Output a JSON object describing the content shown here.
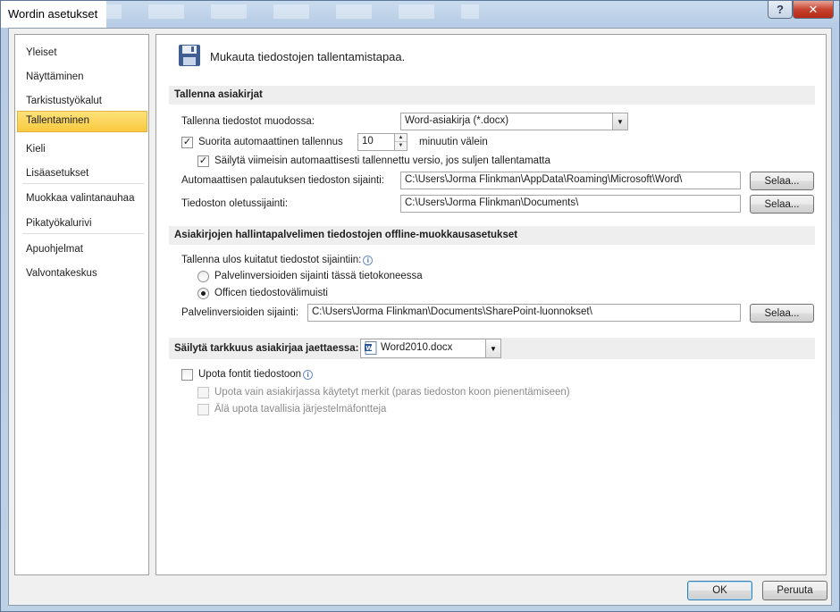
{
  "window": {
    "title": "Wordin asetukset",
    "help_label": "?",
    "close_label": "✕"
  },
  "sidebar": {
    "items": [
      {
        "label": "Yleiset"
      },
      {
        "label": "Näyttäminen"
      },
      {
        "label": "Tarkistustyökalut"
      },
      {
        "label": "Tallentaminen",
        "selected": true
      },
      {
        "label": "Kieli"
      },
      {
        "label": "Lisäasetukset"
      },
      {
        "label": "Muokkaa valintanauhaa"
      },
      {
        "label": "Pikatyökalurivi"
      },
      {
        "label": "Apuohjelmat"
      },
      {
        "label": "Valvontakeskus"
      }
    ]
  },
  "main": {
    "page_title": "Mukauta tiedostojen tallentamistapaa.",
    "save_docs": {
      "header": "Tallenna asiakirjat",
      "format_label": "Tallenna tiedostot muodossa:",
      "format_value": "Word-asiakirja (*.docx)",
      "autosave_label": "Suorita automaattinen tallennus",
      "autosave_checked": true,
      "autosave_minutes": "10",
      "autosave_suffix": "minuutin välein",
      "keep_last_label": "Säilytä viimeisin automaattisesti tallennettu versio, jos suljen tallentamatta",
      "keep_last_checked": true,
      "autorecover_label": "Automaattisen palautuksen tiedoston sijainti:",
      "autorecover_path": "C:\\Users\\Jorma Flinkman\\AppData\\Roaming\\Microsoft\\Word\\",
      "default_location_label": "Tiedoston oletussijainti:",
      "default_location_path": "C:\\Users\\Jorma Flinkman\\Documents\\",
      "browse_label": "Selaa..."
    },
    "offline": {
      "header": "Asiakirjojen hallintapalvelimen tiedostojen offline-muokkausasetukset",
      "checkout_label": "Tallenna ulos kuitatut tiedostot sijaintiin:",
      "radio_server": "Palvelinversioiden sijainti tässä tietokoneessa",
      "radio_cache": "Officen tiedostovälimuisti",
      "selected_radio": "cache",
      "server_drafts_label": "Palvelinversioiden sijainti:",
      "server_drafts_path": "C:\\Users\\Jorma Flinkman\\Documents\\SharePoint-luonnokset\\",
      "browse_label": "Selaa..."
    },
    "fidelity": {
      "header": "Säilytä tarkkuus asiakirjaa jaettaessa:",
      "document_value": "Word2010.docx",
      "embed_fonts_label": "Upota fontit tiedostoon",
      "embed_fonts_checked": false,
      "embed_used_only_label": "Upota vain asiakirjassa käytetyt merkit (paras tiedoston koon pienentämiseen)",
      "no_common_fonts_label": "Älä upota tavallisia järjestelmäfontteja"
    }
  },
  "footer": {
    "ok_label": "OK",
    "cancel_label": "Peruuta"
  },
  "colors": {
    "selected_nav": "#f9c93f",
    "section_bg": "#eeeeee",
    "close_button": "#c7432f"
  },
  "icons": {
    "page_icon": "floppy-disk-icon",
    "info": "info-icon",
    "doc": "word-document-icon"
  }
}
